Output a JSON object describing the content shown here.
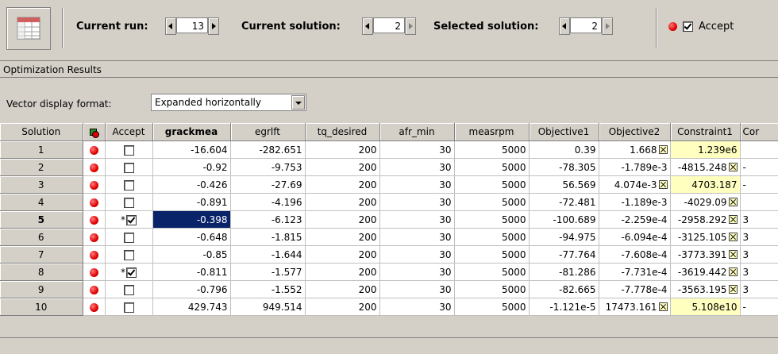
{
  "toolbar": {
    "icon": "table-grid-icon",
    "current_run_label": "Current run:",
    "current_run_value": "13",
    "current_solution_label": "Current solution:",
    "current_solution_value": "2",
    "selected_solution_label": "Selected solution:",
    "selected_solution_value": "2",
    "accept_label": "Accept",
    "accept_checked": true
  },
  "section": {
    "title": "Optimization Results"
  },
  "vector_display": {
    "label": "Vector display format:",
    "value": "Expanded horizontally"
  },
  "table": {
    "headers": [
      "Solution",
      "",
      "Accept",
      "grackmea",
      "egrlft",
      "tq_desired",
      "afr_min",
      "measrpm",
      "Objective1",
      "Objective2",
      "Constraint1",
      "Cor"
    ],
    "rows": [
      {
        "solution": "1",
        "star": "",
        "accept": false,
        "grackmea": "-16.604",
        "egrlft": "-282.651",
        "tq_desired": "200",
        "afr_min": "30",
        "measrpm": "5000",
        "obj1": "0.39",
        "obj2": "1.668",
        "obj2_flag": true,
        "c1": "1.239e6",
        "c1_flag": false,
        "c1_yellow": true,
        "cor": "",
        "cor_flag": false
      },
      {
        "solution": "2",
        "star": "",
        "accept": false,
        "grackmea": "-0.92",
        "egrlft": "-9.753",
        "tq_desired": "200",
        "afr_min": "30",
        "measrpm": "5000",
        "obj1": "-78.305",
        "obj2": "-1.789e-3",
        "obj2_flag": false,
        "c1": "-4815.248",
        "c1_flag": true,
        "c1_yellow": false,
        "cor": "-",
        "cor_flag": false
      },
      {
        "solution": "3",
        "star": "",
        "accept": false,
        "grackmea": "-0.426",
        "egrlft": "-27.69",
        "tq_desired": "200",
        "afr_min": "30",
        "measrpm": "5000",
        "obj1": "56.569",
        "obj2": "4.074e-3",
        "obj2_flag": true,
        "c1": "4703.187",
        "c1_flag": false,
        "c1_yellow": true,
        "cor": "-",
        "cor_flag": false
      },
      {
        "solution": "4",
        "star": "",
        "accept": false,
        "grackmea": "-0.891",
        "egrlft": "-4.196",
        "tq_desired": "200",
        "afr_min": "30",
        "measrpm": "5000",
        "obj1": "-72.481",
        "obj2": "-1.189e-3",
        "obj2_flag": false,
        "c1": "-4029.09",
        "c1_flag": true,
        "c1_yellow": false,
        "cor": "",
        "cor_flag": false
      },
      {
        "solution": "5",
        "star": "*",
        "accept": true,
        "grackmea": "-0.398",
        "egrlft": "-6.123",
        "tq_desired": "200",
        "afr_min": "30",
        "measrpm": "5000",
        "obj1": "-100.689",
        "obj2": "-2.259e-4",
        "obj2_flag": false,
        "c1": "-2958.292",
        "c1_flag": true,
        "c1_yellow": false,
        "cor": "3",
        "cor_flag": false
      },
      {
        "solution": "6",
        "star": "",
        "accept": false,
        "grackmea": "-0.648",
        "egrlft": "-1.815",
        "tq_desired": "200",
        "afr_min": "30",
        "measrpm": "5000",
        "obj1": "-94.975",
        "obj2": "-6.094e-4",
        "obj2_flag": false,
        "c1": "-3125.105",
        "c1_flag": true,
        "c1_yellow": false,
        "cor": "3",
        "cor_flag": false
      },
      {
        "solution": "7",
        "star": "",
        "accept": false,
        "grackmea": "-0.85",
        "egrlft": "-1.644",
        "tq_desired": "200",
        "afr_min": "30",
        "measrpm": "5000",
        "obj1": "-77.764",
        "obj2": "-7.608e-4",
        "obj2_flag": false,
        "c1": "-3773.391",
        "c1_flag": true,
        "c1_yellow": false,
        "cor": "3",
        "cor_flag": false
      },
      {
        "solution": "8",
        "star": "*",
        "accept": true,
        "grackmea": "-0.811",
        "egrlft": "-1.577",
        "tq_desired": "200",
        "afr_min": "30",
        "measrpm": "5000",
        "obj1": "-81.286",
        "obj2": "-7.731e-4",
        "obj2_flag": false,
        "c1": "-3619.442",
        "c1_flag": true,
        "c1_yellow": false,
        "cor": "3",
        "cor_flag": false
      },
      {
        "solution": "9",
        "star": "",
        "accept": false,
        "grackmea": "-0.796",
        "egrlft": "-1.552",
        "tq_desired": "200",
        "afr_min": "30",
        "measrpm": "5000",
        "obj1": "-82.665",
        "obj2": "-7.778e-4",
        "obj2_flag": false,
        "c1": "-3563.195",
        "c1_flag": true,
        "c1_yellow": false,
        "cor": "3",
        "cor_flag": false
      },
      {
        "solution": "10",
        "star": "",
        "accept": false,
        "grackmea": "429.743",
        "egrlft": "949.514",
        "tq_desired": "200",
        "afr_min": "30",
        "measrpm": "5000",
        "obj1": "-1.121e-5",
        "obj2": "17473.161",
        "obj2_flag": true,
        "c1": "5.108e10",
        "c1_flag": false,
        "c1_yellow": true,
        "cor": "-",
        "cor_flag": false
      }
    ]
  },
  "selection": {
    "row": "5",
    "column": "grackmea"
  },
  "colors": {
    "selection": "#0a246a",
    "constraint_violation": "#ffffc0",
    "status_dot": "#e00000"
  }
}
